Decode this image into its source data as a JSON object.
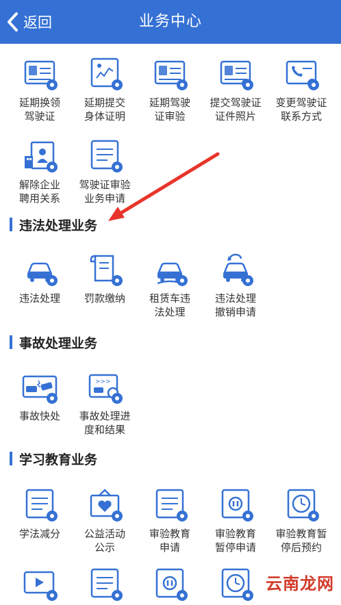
{
  "header": {
    "back_label": "返回",
    "title": "业务中心"
  },
  "colors": {
    "primary": "#3571d4",
    "arrow": "#e8352b",
    "watermark": "#d23a2a"
  },
  "license_items": [
    {
      "label": "延期换领\n驾驶证",
      "icon": "license-card-icon"
    },
    {
      "label": "延期提交\n身体证明",
      "icon": "health-certificate-icon"
    },
    {
      "label": "延期驾驶\n证审验",
      "icon": "license-review-icon"
    },
    {
      "label": "提交驾驶证\n证件照片",
      "icon": "license-photo-upload-icon"
    },
    {
      "label": "变更驾驶证\n联系方式",
      "icon": "contact-change-icon"
    },
    {
      "label": "解除企业\n聘用关系",
      "icon": "enterprise-employment-icon"
    },
    {
      "label": "驾驶证审验\n业务申请",
      "icon": "review-application-icon"
    }
  ],
  "violation": {
    "title": "违法处理业务",
    "items": [
      {
        "label": "违法处理",
        "icon": "violation-car-icon"
      },
      {
        "label": "罚款缴纳",
        "icon": "fine-payment-icon"
      },
      {
        "label": "租赁车违\n法处理",
        "icon": "rental-car-violation-icon"
      },
      {
        "label": "违法处理\n撤销申请",
        "icon": "violation-revoke-icon"
      }
    ]
  },
  "accident": {
    "title": "事故处理业务",
    "items": [
      {
        "label": "事故快处",
        "icon": "accident-quick-icon"
      },
      {
        "label": "事故处理进\n度和结果",
        "icon": "accident-progress-icon"
      }
    ]
  },
  "education": {
    "title": "学习教育业务",
    "items": [
      {
        "label": "学法减分",
        "icon": "study-deduction-icon"
      },
      {
        "label": "公益活动\n公示",
        "icon": "public-welfare-icon"
      },
      {
        "label": "审验教育\n申请",
        "icon": "review-education-icon"
      },
      {
        "label": "审验教育\n暂停申请",
        "icon": "education-pause-icon"
      },
      {
        "label": "审验教育暂\n停后预约",
        "icon": "education-appointment-icon"
      }
    ],
    "bottom_icons": [
      "video-review-icon",
      "doc-12-icon",
      "pause-12-icon",
      "clock-12-icon"
    ]
  },
  "watermark": "云南龙网"
}
